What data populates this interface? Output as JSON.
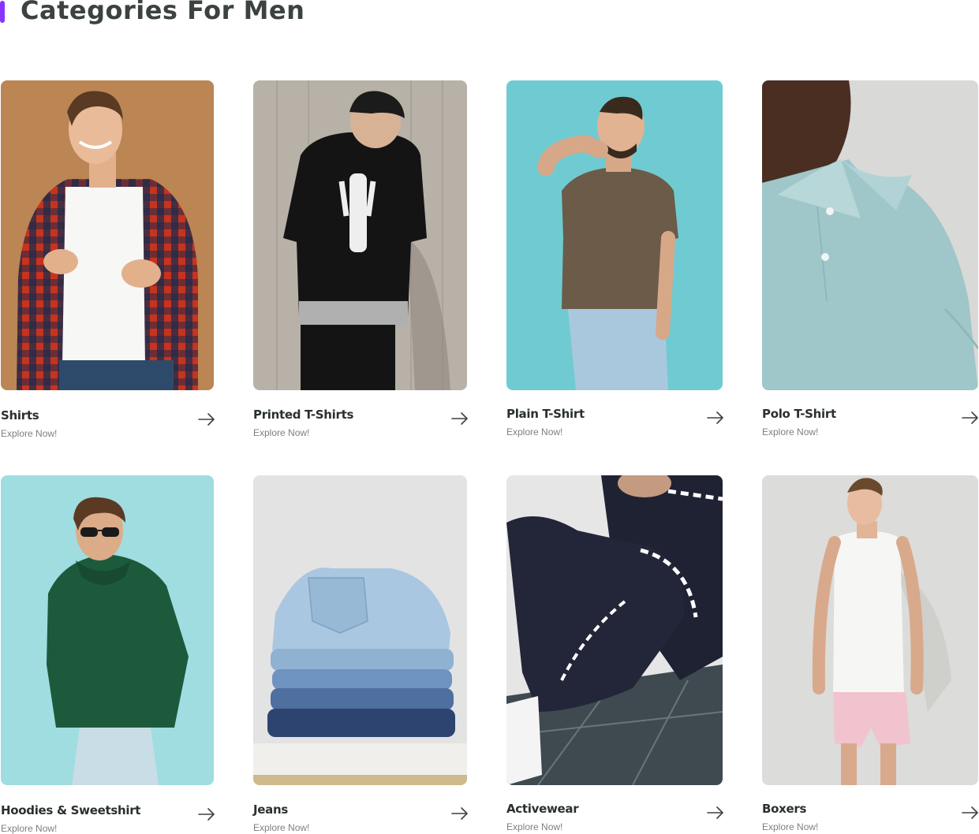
{
  "section": {
    "title": "Categories For Men",
    "accent_color": "#8a33fd"
  },
  "cta_label": "Explore Now!",
  "arrow_icon": "arrow-right-icon",
  "categories": [
    {
      "name": "Shirts",
      "image": "man-in-checkered-shirt-on-tan-background"
    },
    {
      "name": "Printed T-Shirts",
      "image": "man-in-black-skeleton-print-tee-against-concrete-wall"
    },
    {
      "name": "Plain T-Shirt",
      "image": "man-in-olive-plain-tee-against-teal-wall"
    },
    {
      "name": "Polo T-Shirt",
      "image": "close-up-of-light-blue-polo-shirt"
    },
    {
      "name": "Hoodies & Sweetshirt",
      "image": "man-in-green-hoodie-with-sunglasses-on-teal-wall"
    },
    {
      "name": "Jeans",
      "image": "stack-of-folded-denim-jeans"
    },
    {
      "name": "Activewear",
      "image": "man-in-navy-tracksuit-sitting-on-tiled-floor"
    },
    {
      "name": "Boxers",
      "image": "man-in-white-tank-top-and-pink-shorts"
    }
  ]
}
